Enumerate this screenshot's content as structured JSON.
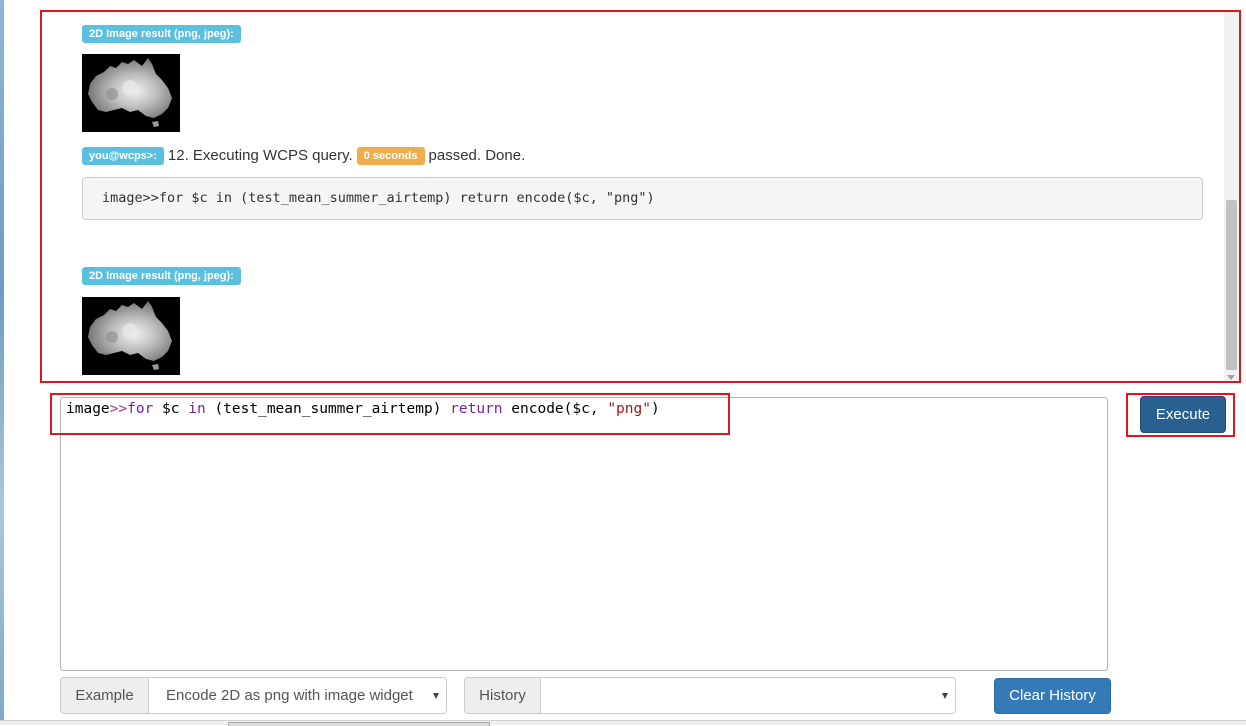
{
  "console": {
    "entries": [
      {
        "result_badge": "2D Image result (png, jpeg):",
        "image_alt": "Australia mean summer air temperature grayscale image"
      },
      {
        "prompt_badge": "you@wcps>:",
        "message": "12. Executing WCPS query.",
        "time_badge": "0 seconds",
        "status": "passed. Done.",
        "query": "image>>for $c in (test_mean_summer_airtemp) return encode($c, \"png\")"
      },
      {
        "result_badge": "2D Image result (png, jpeg):",
        "image_alt": "Australia mean summer air temperature grayscale image"
      }
    ]
  },
  "editor": {
    "tokens": {
      "prefix": "image",
      "op": ">>",
      "kw_for": "for",
      "var1": " $c ",
      "kw_in": "in",
      "mid": " (test_mean_summer_airtemp) ",
      "kw_return": "return",
      "func": " encode($c, ",
      "str": "\"png\"",
      "close": ")"
    }
  },
  "toolbar": {
    "execute_label": "Execute",
    "example_label": "Example",
    "example_selected": "Encode 2D as png with image widget",
    "history_label": "History",
    "history_selected": "",
    "clear_history_label": "Clear History"
  },
  "colors": {
    "highlight": "#e0161b",
    "primary_dark": "#286090",
    "primary": "#337ab7",
    "info_badge": "#5bc0de",
    "warning_badge": "#f0ad4e"
  },
  "icons": [
    "australia-map-image",
    "dropdown-caret-icon"
  ]
}
